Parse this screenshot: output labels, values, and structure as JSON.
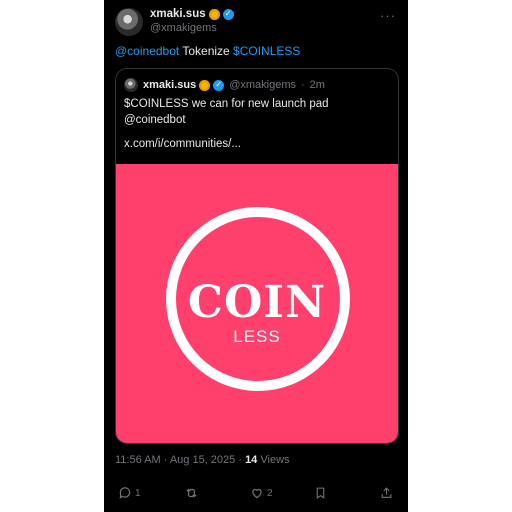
{
  "author": {
    "display_name": "xmaki.sus",
    "handle": "@xmakigems"
  },
  "tweet": {
    "mention": "@coinedbot",
    "text_middle": " Tokenize ",
    "cashtag": "$COINLESS"
  },
  "quote": {
    "display_name": "xmaki.sus",
    "handle": "@xmakigems",
    "separator": "·",
    "time": "2m",
    "line1": "$COINLESS we can for new launch pad",
    "line2": "@coinedbot",
    "line3": "x.com/i/communities/...",
    "image": {
      "title": "COIN",
      "subtitle": "LESS",
      "bg_color": "#ff3f6c"
    }
  },
  "meta": {
    "timestamp": "11:56 AM · Aug 15, 2025 · ",
    "views_count": "14",
    "views_label": " Views"
  },
  "actions": {
    "reply_count": "1",
    "repost_count": "",
    "like_count": "2"
  },
  "colors": {
    "link": "#1d9bf0",
    "verified": "#1d9bf0",
    "muted": "#71767b"
  }
}
